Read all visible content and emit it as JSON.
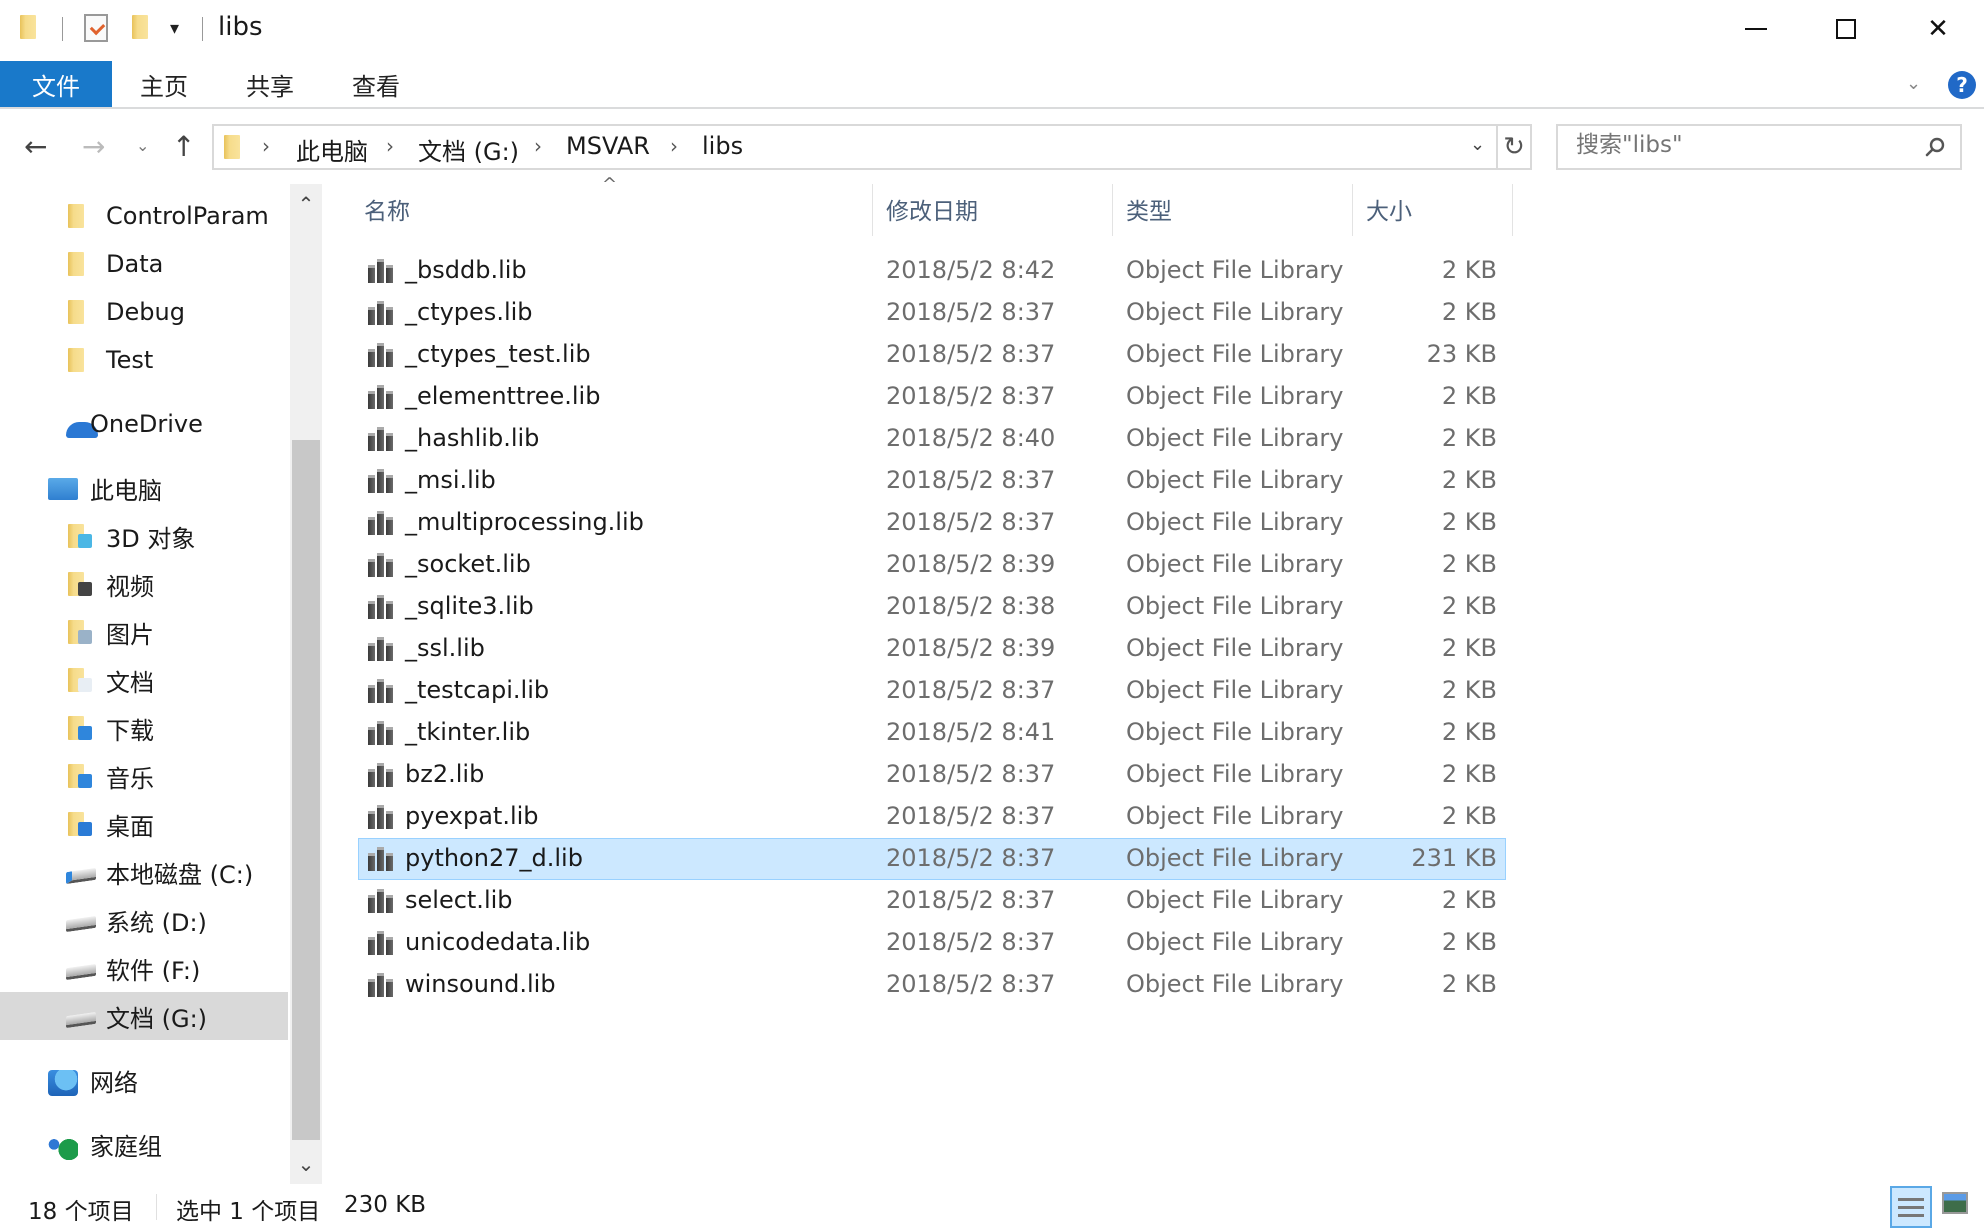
{
  "window": {
    "title": "libs",
    "quick_access_dropdown": "▾",
    "minimize": "minimize",
    "maximize": "maximize",
    "close": "✕"
  },
  "ribbon": {
    "tabs": [
      {
        "label": "文件",
        "active": true
      },
      {
        "label": "主页"
      },
      {
        "label": "共享"
      },
      {
        "label": "查看"
      }
    ],
    "expand_icon": "⌄",
    "help_icon": "?",
    "accent_color": "#1979ca"
  },
  "nav": {
    "back": "←",
    "forward": "→",
    "recent": "⌄",
    "up": "↑",
    "breadcrumb": [
      "此电脑",
      "文档 (G:)",
      "MSVAR",
      "libs"
    ],
    "crumb_sep": "›",
    "address_dropdown": "⌄",
    "refresh": "↻",
    "search_placeholder": "搜索\"libs\""
  },
  "sidebar": {
    "items": [
      {
        "label": "ControlParam",
        "icon": "folder-icon"
      },
      {
        "label": "Data",
        "icon": "folder-icon"
      },
      {
        "label": "Debug",
        "icon": "folder-icon"
      },
      {
        "label": "Test",
        "icon": "folder-icon"
      },
      {
        "label": "OneDrive",
        "icon": "onedrive-icon"
      },
      {
        "label": "此电脑",
        "icon": "this-pc-icon"
      },
      {
        "label": "3D 对象",
        "icon": "3d-objects-icon"
      },
      {
        "label": "视频",
        "icon": "videos-icon"
      },
      {
        "label": "图片",
        "icon": "pictures-icon"
      },
      {
        "label": "文档",
        "icon": "documents-icon"
      },
      {
        "label": "下载",
        "icon": "downloads-icon"
      },
      {
        "label": "音乐",
        "icon": "music-icon"
      },
      {
        "label": "桌面",
        "icon": "desktop-icon"
      },
      {
        "label": "本地磁盘 (C:)",
        "icon": "system-drive-icon"
      },
      {
        "label": "系统 (D:)",
        "icon": "drive-icon"
      },
      {
        "label": "软件 (F:)",
        "icon": "drive-icon"
      },
      {
        "label": "文档 (G:)",
        "icon": "drive-icon",
        "selected": true
      },
      {
        "label": "网络",
        "icon": "network-icon"
      },
      {
        "label": "家庭组",
        "icon": "homegroup-icon"
      }
    ],
    "scroll_up": "⌃",
    "scroll_down": "⌄"
  },
  "file_list": {
    "columns": [
      "名称",
      "修改日期",
      "类型",
      "大小"
    ],
    "sort_indicator": "^",
    "rows": [
      {
        "name": "_bsddb.lib",
        "date": "2018/5/2 8:42",
        "type": "Object File Library",
        "size": "2 KB"
      },
      {
        "name": "_ctypes.lib",
        "date": "2018/5/2 8:37",
        "type": "Object File Library",
        "size": "2 KB"
      },
      {
        "name": "_ctypes_test.lib",
        "date": "2018/5/2 8:37",
        "type": "Object File Library",
        "size": "23 KB"
      },
      {
        "name": "_elementtree.lib",
        "date": "2018/5/2 8:37",
        "type": "Object File Library",
        "size": "2 KB"
      },
      {
        "name": "_hashlib.lib",
        "date": "2018/5/2 8:40",
        "type": "Object File Library",
        "size": "2 KB"
      },
      {
        "name": "_msi.lib",
        "date": "2018/5/2 8:37",
        "type": "Object File Library",
        "size": "2 KB"
      },
      {
        "name": "_multiprocessing.lib",
        "date": "2018/5/2 8:37",
        "type": "Object File Library",
        "size": "2 KB"
      },
      {
        "name": "_socket.lib",
        "date": "2018/5/2 8:39",
        "type": "Object File Library",
        "size": "2 KB"
      },
      {
        "name": "_sqlite3.lib",
        "date": "2018/5/2 8:38",
        "type": "Object File Library",
        "size": "2 KB"
      },
      {
        "name": "_ssl.lib",
        "date": "2018/5/2 8:39",
        "type": "Object File Library",
        "size": "2 KB"
      },
      {
        "name": "_testcapi.lib",
        "date": "2018/5/2 8:37",
        "type": "Object File Library",
        "size": "2 KB"
      },
      {
        "name": "_tkinter.lib",
        "date": "2018/5/2 8:41",
        "type": "Object File Library",
        "size": "2 KB"
      },
      {
        "name": "bz2.lib",
        "date": "2018/5/2 8:37",
        "type": "Object File Library",
        "size": "2 KB"
      },
      {
        "name": "pyexpat.lib",
        "date": "2018/5/2 8:37",
        "type": "Object File Library",
        "size": "2 KB"
      },
      {
        "name": "python27_d.lib",
        "date": "2018/5/2 8:37",
        "type": "Object File Library",
        "size": "231 KB",
        "selected": true
      },
      {
        "name": "select.lib",
        "date": "2018/5/2 8:37",
        "type": "Object File Library",
        "size": "2 KB"
      },
      {
        "name": "unicodedata.lib",
        "date": "2018/5/2 8:37",
        "type": "Object File Library",
        "size": "2 KB"
      },
      {
        "name": "winsound.lib",
        "date": "2018/5/2 8:37",
        "type": "Object File Library",
        "size": "2 KB"
      }
    ],
    "selection_color": "#cce8ff"
  },
  "status": {
    "item_count": "18 个项目",
    "selected": "选中 1 个项目",
    "selected_size": "230 KB"
  }
}
